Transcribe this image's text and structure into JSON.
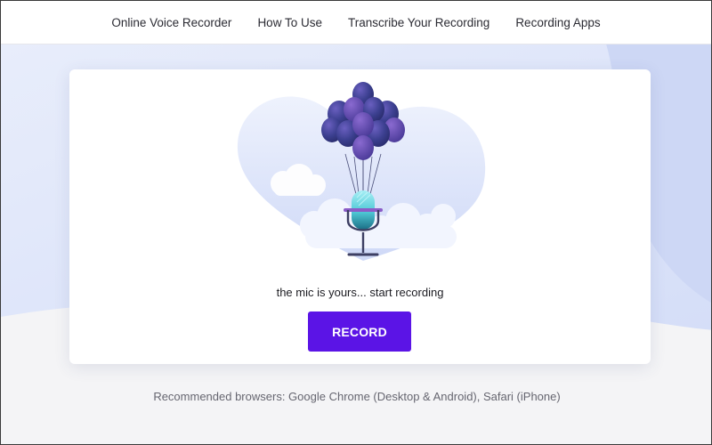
{
  "nav": {
    "items": [
      {
        "label": "Online Voice Recorder"
      },
      {
        "label": "How To Use"
      },
      {
        "label": "Transcribe Your Recording"
      },
      {
        "label": "Recording Apps"
      }
    ]
  },
  "recorder": {
    "tagline": "the mic is yours... start recording",
    "record_label": "RECORD"
  },
  "footer": {
    "browsers_note": "Recommended browsers: Google Chrome (Desktop & Android), Safari (iPhone)"
  },
  "colors": {
    "accent": "#5b14e6",
    "balloon": "#3b3f8f",
    "background_wave": "#dfe6fb"
  }
}
